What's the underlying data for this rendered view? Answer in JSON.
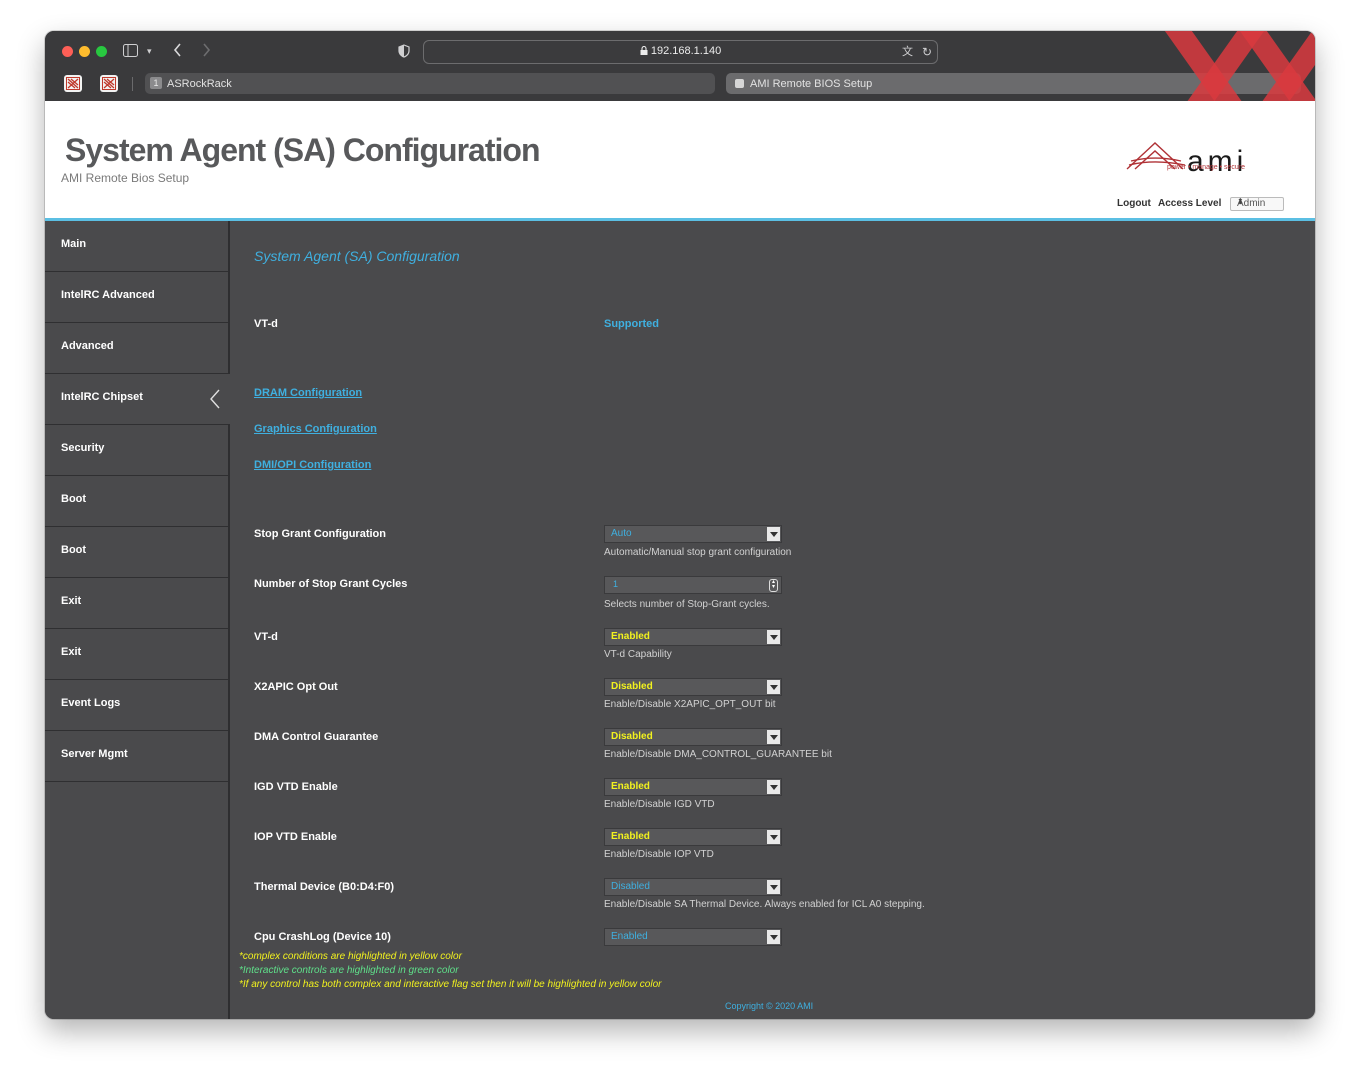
{
  "browser": {
    "url": "192.168.1.140",
    "tabs": [
      {
        "number": "1",
        "label": "ASRockRack"
      },
      {
        "label": "AMI Remote BIOS Setup"
      }
    ]
  },
  "header": {
    "title": "System Agent (SA) Configuration",
    "subtitle": "AMI Remote Bios Setup",
    "logo_text": "ami",
    "logo_tagline": "power • manage • secure",
    "logout": "Logout",
    "access_level_label": "Access Level",
    "access_level_value": "Admin"
  },
  "sidebar": {
    "items": [
      {
        "label": "Main"
      },
      {
        "label": "IntelRC Advanced"
      },
      {
        "label": "Advanced"
      },
      {
        "label": "IntelRC Chipset",
        "active": true
      },
      {
        "label": "Security"
      },
      {
        "label": "Boot"
      },
      {
        "label": "Boot"
      },
      {
        "label": "Exit"
      },
      {
        "label": "Exit"
      },
      {
        "label": "Event Logs"
      },
      {
        "label": "Server Mgmt"
      }
    ]
  },
  "main": {
    "section_title": "System Agent (SA) Configuration",
    "vtd_label": "VT-d",
    "vtd_value": "Supported",
    "links": [
      "DRAM Configuration",
      "Graphics Configuration",
      "DMI/OPI Configuration"
    ],
    "settings": [
      {
        "label": "Stop Grant Configuration",
        "value": "Auto",
        "help": "Automatic/Manual stop grant configuration"
      },
      {
        "label": "Number of Stop Grant Cycles",
        "value": "1",
        "help": "Selects number of Stop-Grant cycles."
      },
      {
        "label": "VT-d",
        "value": "Enabled",
        "help": "VT-d Capability"
      },
      {
        "label": "X2APIC Opt Out",
        "value": "Disabled",
        "help": "Enable/Disable X2APIC_OPT_OUT bit"
      },
      {
        "label": "DMA Control Guarantee",
        "value": "Disabled",
        "help": "Enable/Disable DMA_CONTROL_GUARANTEE bit"
      },
      {
        "label": "IGD VTD Enable",
        "value": "Enabled",
        "help": "Enable/Disable IGD VTD"
      },
      {
        "label": "IOP VTD Enable",
        "value": "Enabled",
        "help": "Enable/Disable IOP VTD"
      },
      {
        "label": "Thermal Device (B0:D4:F0)",
        "value": "Disabled",
        "help": "Enable/Disable SA Thermal Device. Always enabled for ICL A0 stepping."
      },
      {
        "label": "Cpu CrashLog (Device 10)",
        "value": "Enabled",
        "help": ""
      }
    ],
    "notes": [
      "*complex conditions are highlighted in yellow color",
      "*Interactive controls are highlighted in green color",
      "*If any control has both complex and interactive flag set then it will be highlighted in yellow color"
    ],
    "copyright": "Copyright © 2020 AMI"
  },
  "colors": {
    "accent": "#3fb0e0",
    "complex_highlight": "#f2f21e",
    "interactive_highlight": "#5fe08a",
    "panel_bg": "#4a4a4c"
  }
}
